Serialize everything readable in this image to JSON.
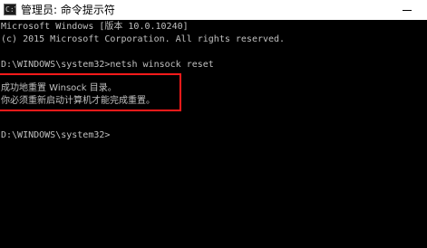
{
  "window": {
    "title": "管理员: 命令提示符",
    "icon": "cmd-icon",
    "icon_glyph": "C:\\"
  },
  "console": {
    "lines": [
      "Microsoft Windows [版本 10.0.10240]",
      "(c) 2015 Microsoft Corporation. All rights reserved.",
      "",
      "D:\\WINDOWS\\system32>netsh winsock reset",
      "",
      "成功地重置 Winsock 目录。",
      "你必须重新启动计算机才能完成重置。",
      "",
      "",
      "D:\\WINDOWS\\system32>"
    ]
  },
  "colors": {
    "console_background": "#000000",
    "console_text": "#c0c0c0",
    "highlight_border": "#ff1a1a"
  }
}
